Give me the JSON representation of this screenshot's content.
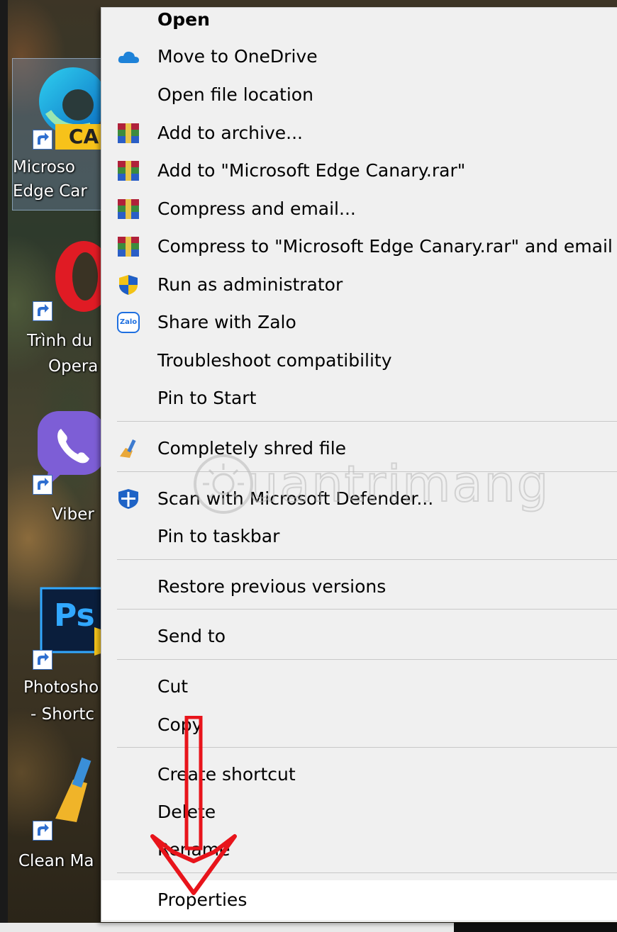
{
  "desktop": {
    "icons": [
      {
        "label_line1": "Microso",
        "label_line2": "Edge Car",
        "badge": "CA",
        "selected": true,
        "icon": "edge-canary-icon"
      },
      {
        "label_line1": "Trình du",
        "label_line2": "Opera",
        "icon": "opera-icon"
      },
      {
        "label_line1": "Viber",
        "icon": "viber-icon"
      },
      {
        "label_line1": "Photosho",
        "label_line2": "- Shortc",
        "badge": "Ps",
        "icon": "photoshop-icon"
      },
      {
        "label_line1": "Clean Ma",
        "icon": "clean-master-icon"
      }
    ]
  },
  "menu": {
    "items": [
      {
        "label": "Open",
        "bold": true,
        "icon": "none"
      },
      {
        "label": "Move to OneDrive",
        "icon": "onedrive-icon"
      },
      {
        "label": "Open file location",
        "icon": "none"
      },
      {
        "label": "Add to archive...",
        "icon": "winrar-icon"
      },
      {
        "label": "Add to \"Microsoft Edge Canary.rar\"",
        "icon": "winrar-icon"
      },
      {
        "label": "Compress and email...",
        "icon": "winrar-icon"
      },
      {
        "label": "Compress to \"Microsoft Edge Canary.rar\" and email",
        "icon": "winrar-icon"
      },
      {
        "label": "Run as administrator",
        "icon": "uac-shield-icon"
      },
      {
        "label": "Share with Zalo",
        "icon": "zalo-icon",
        "icon_text": "Zalo"
      },
      {
        "label": "Troubleshoot compatibility",
        "icon": "none"
      },
      {
        "label": "Pin to Start",
        "icon": "none"
      },
      {
        "label": "Completely shred file",
        "icon": "shred-broom-icon"
      },
      {
        "label": "Scan with Microsoft Defender...",
        "icon": "defender-icon"
      },
      {
        "label": "Pin to taskbar",
        "icon": "none"
      },
      {
        "label": "Restore previous versions",
        "icon": "none"
      },
      {
        "label": "Send to",
        "icon": "none"
      },
      {
        "label": "Cut",
        "icon": "none"
      },
      {
        "label": "Copy",
        "icon": "none"
      },
      {
        "label": "Create shortcut",
        "icon": "none"
      },
      {
        "label": "Delete",
        "icon": "none"
      },
      {
        "label": "Rename",
        "icon": "none"
      },
      {
        "label": "Properties",
        "icon": "none",
        "highlighted": true
      }
    ]
  },
  "watermark": {
    "text": "uantrimang"
  },
  "colors": {
    "menu_bg": "#f0f0f0",
    "highlight": "#ffffff",
    "arrow": "#e8141b",
    "separator": "#c8c8c8"
  }
}
